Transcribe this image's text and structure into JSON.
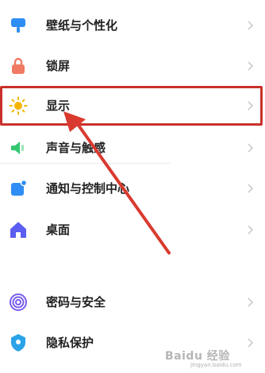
{
  "settings": {
    "items": [
      {
        "label": "壁纸与个性化",
        "icon": "palette-icon",
        "color": "#2f8ef4"
      },
      {
        "label": "锁屏",
        "icon": "lock-icon",
        "color": "#f07a63"
      },
      {
        "label": "显示",
        "icon": "sun-icon",
        "color": "#f5b400"
      },
      {
        "label": "声音与触感",
        "icon": "speaker-icon",
        "color": "#34c770"
      },
      {
        "label": "通知与控制中心",
        "icon": "notification-icon",
        "color": "#2f8ef4"
      },
      {
        "label": "桌面",
        "icon": "home-icon",
        "color": "#5b5ef0"
      },
      {
        "label": "密码与安全",
        "icon": "fingerprint-icon",
        "color": "#7a5cf0"
      },
      {
        "label": "隐私保护",
        "icon": "shield-icon",
        "color": "#2aa3e8"
      }
    ]
  },
  "annotation": {
    "color": "#d93a2f"
  },
  "watermark": {
    "text": "Baidu 经验",
    "sub": "jingyan.baidu.com"
  }
}
